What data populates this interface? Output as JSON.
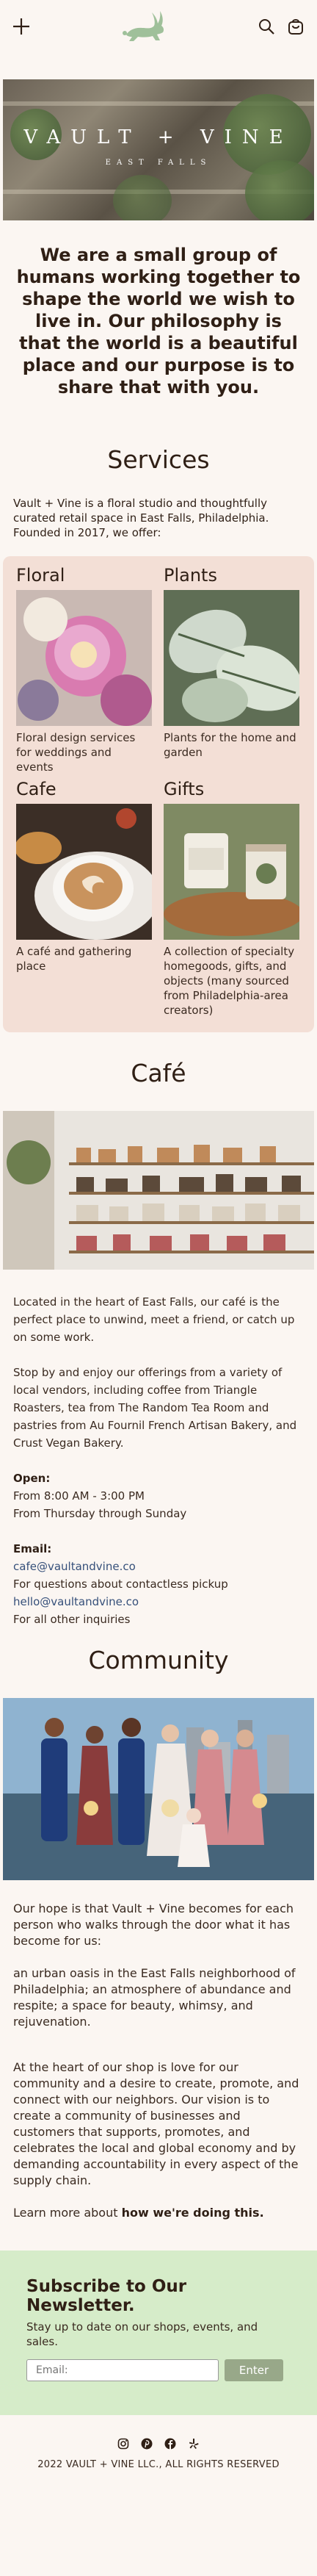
{
  "header": {
    "menu_icon": "plus-icon",
    "logo_icon": "rabbit-icon",
    "search_icon": "search-icon",
    "cart_icon": "shopping-bag-icon"
  },
  "hero": {
    "brand": "VAULT + VINE",
    "tagline": "EAST FALLS"
  },
  "intro": "We are a small group of humans working together to shape the world we wish to live in. Our philosophy is that the world is a beautiful place and our purpose is to share that with you.",
  "services": {
    "title": "Services",
    "lead": "Vault + Vine is a floral studio and thoughtfully curated retail space in East Falls, Philadelphia. Founded in 2017, we offer:",
    "items": [
      {
        "title": "Floral",
        "desc": "Floral design services for weddings and events"
      },
      {
        "title": "Plants",
        "desc": "Plants for the home and garden"
      },
      {
        "title": "Cafe",
        "desc": "A café and gathering place"
      },
      {
        "title": "Gifts",
        "desc": "A collection of specialty homegoods, gifts, and objects (many sourced from Philadelphia-area creators)"
      }
    ]
  },
  "cafe": {
    "title": "Café",
    "p1": "Located in the heart of East Falls, our café is the perfect place to unwind, meet a friend, or catch up on some work.",
    "p2": "Stop by and enjoy our offerings from a variety of local vendors, including coffee from Triangle Roasters, tea from The Random Tea Room and pastries from Au Fournil French Artisan Bakery, and Crust Vegan Bakery.",
    "open_label": "Open:",
    "hours": "From 8:00 AM - 3:00 PM",
    "days": "From Thursday through Sunday",
    "email_label": "Email:",
    "email1": "cafe@vaultandvine.co",
    "email1_note": "For questions about contactless pickup",
    "email2": "hello@vaultandvine.co",
    "email2_note": "For all other inquiries"
  },
  "community": {
    "title": "Community",
    "p1": "Our hope is that Vault + Vine becomes for each person who walks through the door what it has become for us:",
    "p2": "an urban oasis in the East Falls neighborhood of Philadelphia; an atmosphere of abundance and respite; a space for beauty, whimsy, and rejuvenation.",
    "p3": "At the heart of our shop is love for our community and a desire to create, promote, and connect with our neighbors. Our vision is to create a community of businesses and customers that supports, promotes, and celebrates the local and global economy and by demanding accountability in every aspect of the supply chain.",
    "learn_prefix": "Learn more about ",
    "learn_link": "how we're doing this."
  },
  "newsletter": {
    "title": "Subscribe to Our Newsletter.",
    "subtitle": "Stay up to date on our shops, events, and sales.",
    "email_placeholder": "Email:",
    "button": "Enter"
  },
  "footer": {
    "socials": [
      "instagram-icon",
      "pinterest-icon",
      "facebook-icon",
      "yelp-icon"
    ],
    "copyright": "2022 VAULT + VINE LLC., ALL RIGHTS RESERVED"
  },
  "colors": {
    "background": "#fbf6f2",
    "services_panel": "#f3dfd6",
    "newsletter_panel": "#d6ecc9",
    "logo_green": "#9fc09a",
    "link": "#36507a",
    "button": "#98a889"
  }
}
